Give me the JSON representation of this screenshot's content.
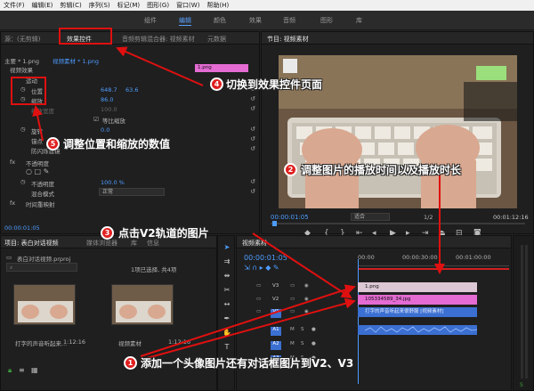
{
  "menu": [
    "文件(F)",
    "编辑(E)",
    "剪辑(C)",
    "序列(S)",
    "标记(M)",
    "图形(G)",
    "窗口(W)",
    "帮助(H)"
  ],
  "workspace_tabs": [
    "组件",
    "编辑",
    "颜色",
    "效果",
    "音频",
    "图形",
    "库"
  ],
  "workspace_active": "编辑",
  "effect_panel": {
    "tabs": [
      "源：(无剪辑)",
      "效果控件",
      "音频剪辑混合器: 视频素材",
      "元数据"
    ],
    "master_label": "主要 * 1.png",
    "sequence_label": "视频素材 * 1.png",
    "section_video": "视频效果",
    "motion": "运动",
    "position_label": "位置",
    "position_x": "648.7",
    "position_y": "63.6",
    "scale_label": "缩放",
    "scale_value": "86.0",
    "scale_width_label": "缩放宽度",
    "scale_width_value": "100.0",
    "uniform_scale": "等比缩放",
    "rotation_label": "旋转",
    "rotation_value": "0.0",
    "anchor_label": "锚点",
    "flicker_label": "防闪烁滤镜",
    "opacity_section": "不透明度",
    "opacity_label": "不透明度",
    "opacity_value": "100.0 %",
    "blend_label": "混合模式",
    "blend_value": "正常",
    "time_remap": "时间重映射",
    "clip_name": "1.png",
    "timecode": "00:00:01:05"
  },
  "program_panel": {
    "title": "节目: 视频素材",
    "timecode": "00:00:01:05",
    "fit": "适合",
    "quality": "1/2",
    "duration": "00:01:12:16"
  },
  "project_panel": {
    "tabs": [
      "项目: 表白对话视频",
      "媒体浏览器",
      "库",
      "信息"
    ],
    "project_file": "表白对话视频.prproj",
    "selection_info": "1项已选择, 共4项",
    "items": [
      {
        "name": "打字的声音听起来...",
        "duration": "1:12:16"
      },
      {
        "name": "视频素材",
        "duration": "1:12:16"
      }
    ]
  },
  "timeline": {
    "title": "视频素材",
    "timecode": "00:00:01:05",
    "ruler": [
      "00:00",
      "00:00:30:00",
      "00:01:00:00"
    ],
    "tracks": [
      "V3",
      "V2",
      "V1",
      "A1",
      "A2",
      "A3"
    ],
    "clips": {
      "v3": "1.png",
      "v2": "105334589_34.jpg",
      "v1": "打字的声音听起来很舒服 [视频素材]",
      "a1": ""
    }
  },
  "annotations": {
    "a1": {
      "num": "1",
      "text": "添加一个头像图片还有对话框图片到V2、V3"
    },
    "a2": {
      "num": "2",
      "text": "调整图片的播放时间以及播放时长"
    },
    "a3": {
      "num": "3",
      "text": "点击V2轨道的图片"
    },
    "a4": {
      "num": "4",
      "text": "切换到效果控件页面"
    },
    "a5": {
      "num": "5",
      "text": "调整位置和缩放的数值"
    }
  },
  "colors": {
    "accent": "#4d9cff",
    "annotation_red": "#e01010",
    "clip_pink": "#e36bd2",
    "clip_lightpink": "#dcc7d4",
    "clip_blue": "#3b6fd1"
  }
}
